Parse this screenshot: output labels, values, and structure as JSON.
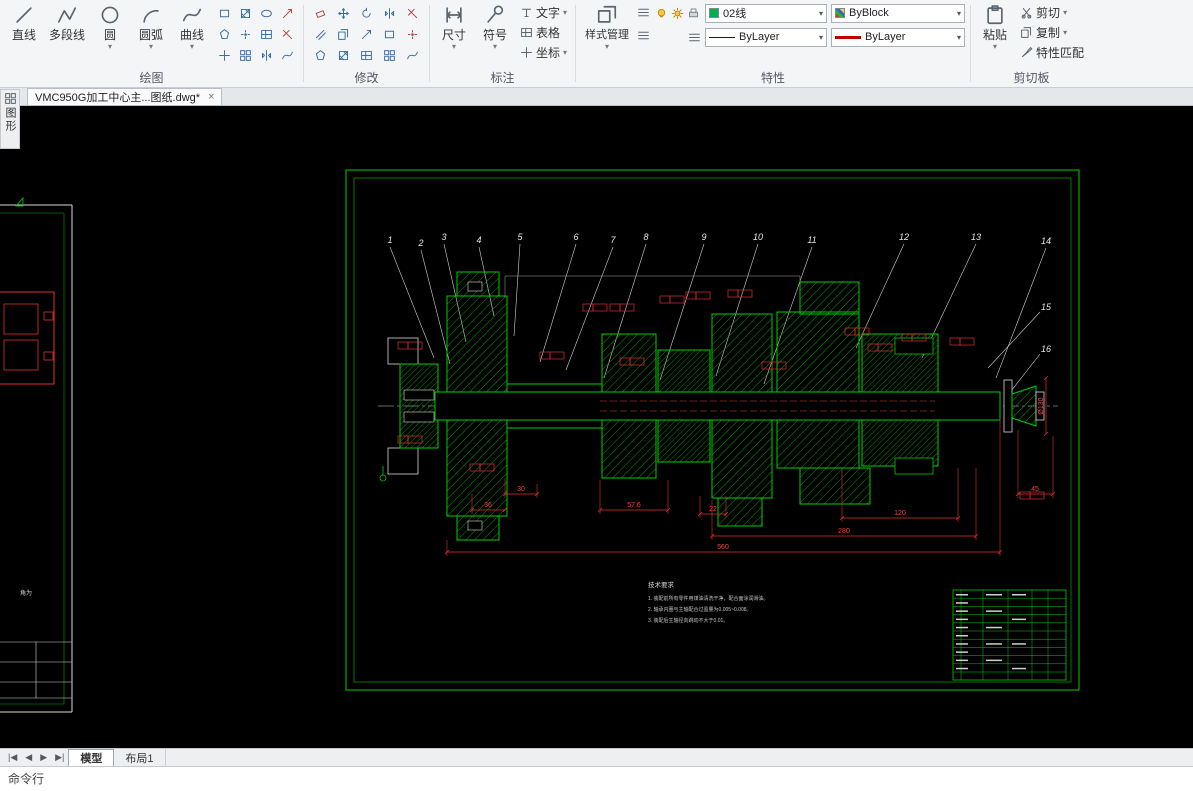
{
  "colors": {
    "cad_green": "#00cc00",
    "cad_red": "#e03030",
    "cad_white": "#d9d9d9",
    "accent_blue": "#3a6ea5",
    "swatch_green": "#00b050"
  },
  "ribbon": {
    "draw": {
      "label": "绘图",
      "big": [
        "直线",
        "多段线",
        "圆",
        "圆弧",
        "曲线"
      ]
    },
    "modify": {
      "label": "修改"
    },
    "annotate": {
      "label": "标注",
      "big": [
        "尺寸",
        "符号"
      ],
      "small": [
        "文字",
        "表格",
        "坐标"
      ]
    },
    "props": {
      "label": "特性",
      "style_button": "样式管理",
      "layer": "02线",
      "color": "ByBlock",
      "linetype": "ByLayer",
      "lineweight": "ByLayer"
    },
    "clipboard": {
      "label": "剪切板",
      "paste": "粘贴",
      "cut": "剪切",
      "copy": "复制",
      "match": "特性匹配"
    }
  },
  "side_tab": {
    "label": "图形"
  },
  "document_tab": {
    "title": "VMC950G加工中心主...图纸.dwg*",
    "close": "×"
  },
  "drawing": {
    "callouts": [
      "1",
      "2",
      "3",
      "4",
      "5",
      "6",
      "7",
      "8",
      "9",
      "10",
      "11",
      "12",
      "13",
      "14",
      "15",
      "16"
    ],
    "dims": {
      "d1": "30",
      "d2": "36",
      "d3": "57.6",
      "d4": "22",
      "d5": "120",
      "d6": "45",
      "d7": "280",
      "d8": "560",
      "dia": "Ø130"
    },
    "notes_title": "技术要求",
    "notes": [
      "1. 装配前所有零件用煤油清洗干净，配合面涂润滑油。",
      "2. 轴承内圈与主轴配合过盈量为0.005~0.008。",
      "3. 装配后主轴径向跳动不大于0.01。"
    ],
    "left_label": "角为"
  },
  "bottom_bar": {
    "nav": [
      "|◀",
      "◀",
      "▶",
      "▶|"
    ],
    "model_tab": "模型",
    "layout_tab": "布局1"
  },
  "command_line": {
    "label": "命令行"
  }
}
